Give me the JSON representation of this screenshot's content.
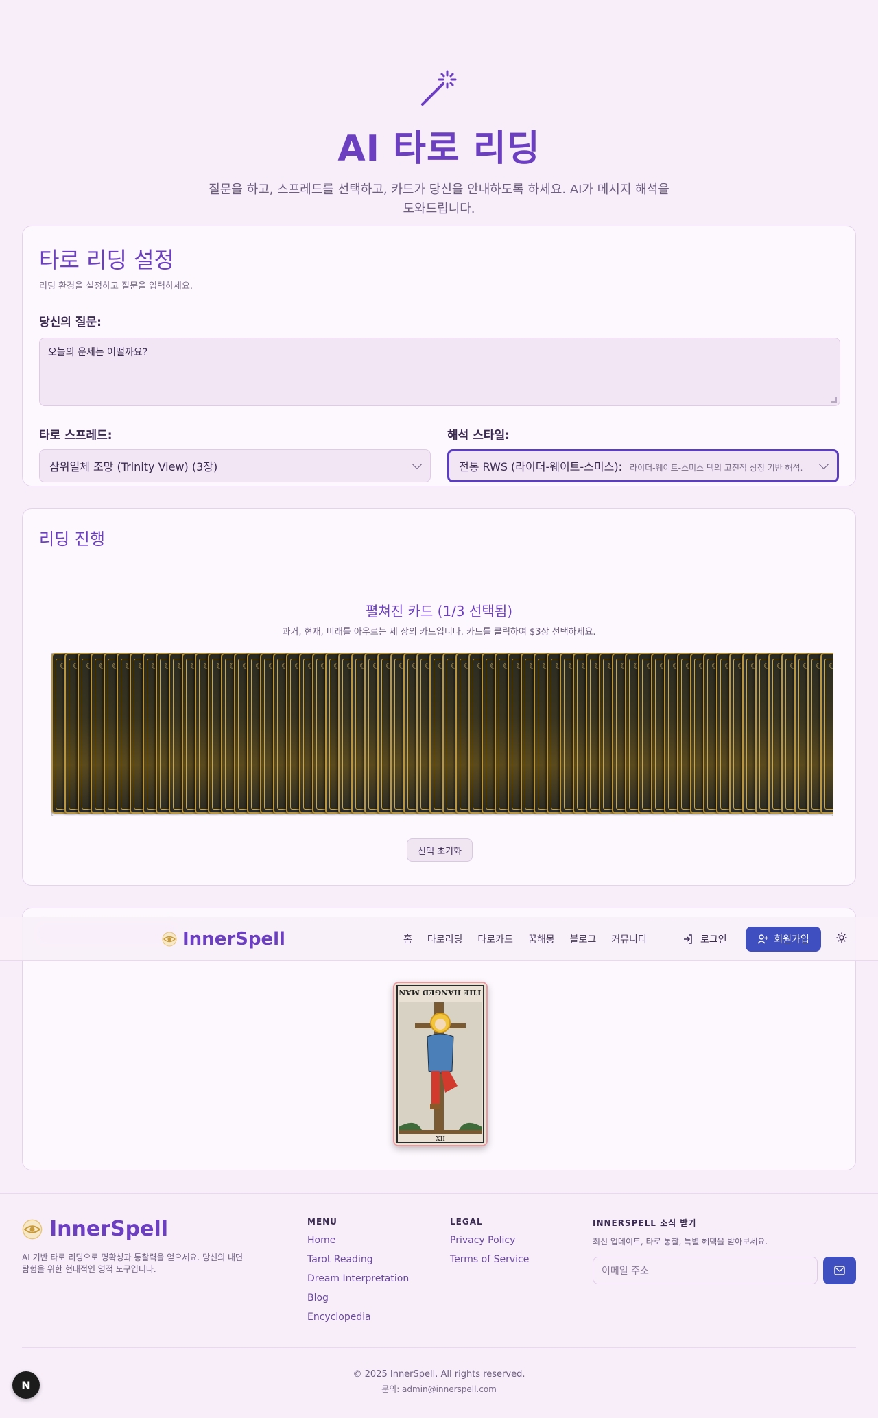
{
  "hero": {
    "title": "AI 타로 리딩",
    "subtitle": "질문을 하고, 스프레드를 선택하고, 카드가 당신을 안내하도록 하세요. AI가 메시지 해석을 도와드립니다."
  },
  "setup": {
    "title": "타로 리딩 설정",
    "description": "리딩 환경을 설정하고 질문을 입력하세요.",
    "question_label": "당신의 질문:",
    "question_value": "오늘의 운세는 어떨까요?",
    "spread_label": "타로 스프레드:",
    "spread_value": "삼위일체 조망 (Trinity View) (3장)",
    "style_label": "해석 스타일:",
    "style_value": "전통 RWS (라이더-웨이트-스미스):",
    "style_sub": "라이더-웨이트-스미스 덱의 고전적 상징 기반 해석."
  },
  "progress": {
    "title": "리딩 진행",
    "spread_title": "펼쳐진 카드 (1/3 선택됨)",
    "spread_desc": "과거, 현재, 미래를 아우르는 세 장의 카드입니다. 카드를 클릭하여 $3장 선택하세요.",
    "reset_label": "선택 초기화"
  },
  "selected": {
    "card_name": "THE HANGED MAN",
    "card_numeral": "XII"
  },
  "nav": {
    "brand": "InnerSpell",
    "links": [
      "홈",
      "타로리딩",
      "타로카드",
      "꿈해몽",
      "블로그",
      "커뮤니티"
    ],
    "login": "로그인",
    "signup": "회원가입"
  },
  "footer": {
    "brand": "InnerSpell",
    "tagline": "AI 기반 타로 리딩으로 명확성과 통찰력을 얻으세요. 당신의 내면 탐험을 위한 현대적인 영적 도구입니다.",
    "menu_title": "MENU",
    "menu": [
      "Home",
      "Tarot Reading",
      "Dream Interpretation",
      "Blog",
      "Encyclopedia"
    ],
    "legal_title": "LEGAL",
    "legal": [
      "Privacy Policy",
      "Terms of Service"
    ],
    "news_title": "INNERSPELL 소식 받기",
    "news_desc": "최신 업데이트, 타로 통찰, 특별 혜택을 받아보세요.",
    "email_placeholder": "이메일 주소",
    "copyright": "© 2025 InnerSpell. All rights reserved.",
    "contact": "문의: admin@innerspell.com"
  },
  "colors": {
    "accent": "#6b3fc0",
    "button": "#3f4fc0",
    "background": "#f7eef9"
  }
}
